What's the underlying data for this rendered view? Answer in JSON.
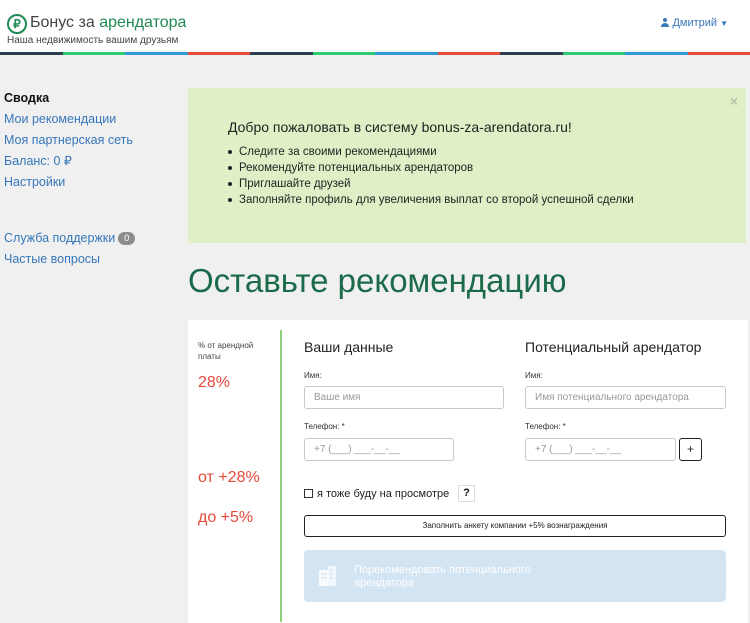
{
  "header": {
    "logo_symbol": "₽",
    "brand_prefix": "Бонус за ",
    "brand_accent": "арендатора",
    "tagline": "Наша недвижимость вашим друзьям",
    "user_name": "Дмитрий",
    "stripe_colors": [
      "#2c3e50",
      "#2ecc71",
      "#3498db",
      "#e74c3c",
      "#2c3e50",
      "#2ecc71",
      "#3498db",
      "#e74c3c",
      "#2c3e50",
      "#2ecc71",
      "#3498db",
      "#e74c3c"
    ]
  },
  "sidebar": {
    "items": [
      {
        "label": "Сводка"
      },
      {
        "label": "Мои рекомендации"
      },
      {
        "label": "Моя партнерская сеть"
      },
      {
        "label": "Баланс: 0 ₽"
      },
      {
        "label": "Настройки"
      }
    ],
    "support": {
      "label": "Служба поддержки",
      "badge": "0"
    },
    "faq": {
      "label": "Частые вопросы"
    }
  },
  "alert": {
    "close": "×",
    "title": "Добро пожаловать в систему bonus-za-arendatora.ru!",
    "items": [
      "Следите за своими рекомендациями",
      "Рекомендуйте потенциальных арендаторов",
      "Приглашайте друзей",
      "Заполняйте профиль для увеличения выплат со второй успешной сделки"
    ]
  },
  "page_title": "Оставьте рекомендацию",
  "form": {
    "rate_label": "% от арендной платы",
    "rate_base": "28%",
    "rate_plus": "от +28%",
    "rate_extra": "до +5%",
    "your_data": {
      "title": "Ваши данные",
      "name_label": "Имя:",
      "name_placeholder": "Ваше имя",
      "phone_label": "Телефон: *",
      "phone_placeholder": "+7 (___) ___-__-__"
    },
    "tenant": {
      "title": "Потенциальный арендатор",
      "name_label": "Имя:",
      "name_placeholder": "Имя потенциального арендатора",
      "phone_label": "Телефон: *",
      "phone_placeholder": "+7 (___) ___-__-__",
      "add_label": "+"
    },
    "viewing_label": "я тоже буду на просмотре",
    "help_label": "?",
    "fill_label": "Заполнить анкету компании +5% вознаграждения",
    "recommend_label": "Порекомендовать потенциального арендатора"
  },
  "colors": {
    "accent_green": "#1f8a55",
    "title_green": "#1b6b4a",
    "rate_red": "#e5493a",
    "link_blue": "#3777bb",
    "alert_bg": "#dff0c7"
  }
}
